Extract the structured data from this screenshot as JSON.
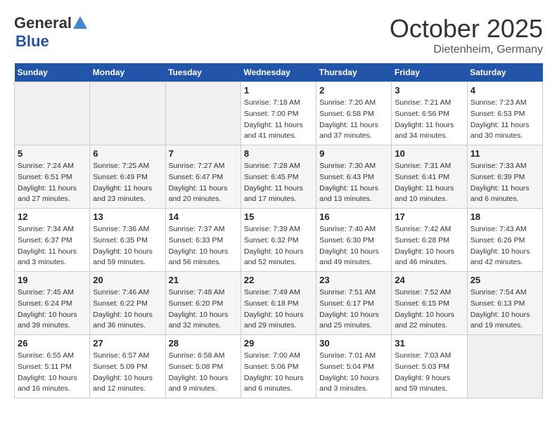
{
  "header": {
    "logo_general": "General",
    "logo_blue": "Blue",
    "month_title": "October 2025",
    "location": "Dietenheim, Germany"
  },
  "weekdays": [
    "Sunday",
    "Monday",
    "Tuesday",
    "Wednesday",
    "Thursday",
    "Friday",
    "Saturday"
  ],
  "weeks": [
    [
      null,
      null,
      null,
      {
        "day": 1,
        "sunrise": "7:18 AM",
        "sunset": "7:00 PM",
        "daylight": "11 hours and 41 minutes."
      },
      {
        "day": 2,
        "sunrise": "7:20 AM",
        "sunset": "6:58 PM",
        "daylight": "11 hours and 37 minutes."
      },
      {
        "day": 3,
        "sunrise": "7:21 AM",
        "sunset": "6:56 PM",
        "daylight": "11 hours and 34 minutes."
      },
      {
        "day": 4,
        "sunrise": "7:23 AM",
        "sunset": "6:53 PM",
        "daylight": "11 hours and 30 minutes."
      }
    ],
    [
      {
        "day": 5,
        "sunrise": "7:24 AM",
        "sunset": "6:51 PM",
        "daylight": "11 hours and 27 minutes."
      },
      {
        "day": 6,
        "sunrise": "7:25 AM",
        "sunset": "6:49 PM",
        "daylight": "11 hours and 23 minutes."
      },
      {
        "day": 7,
        "sunrise": "7:27 AM",
        "sunset": "6:47 PM",
        "daylight": "11 hours and 20 minutes."
      },
      {
        "day": 8,
        "sunrise": "7:28 AM",
        "sunset": "6:45 PM",
        "daylight": "11 hours and 17 minutes."
      },
      {
        "day": 9,
        "sunrise": "7:30 AM",
        "sunset": "6:43 PM",
        "daylight": "11 hours and 13 minutes."
      },
      {
        "day": 10,
        "sunrise": "7:31 AM",
        "sunset": "6:41 PM",
        "daylight": "11 hours and 10 minutes."
      },
      {
        "day": 11,
        "sunrise": "7:33 AM",
        "sunset": "6:39 PM",
        "daylight": "11 hours and 6 minutes."
      }
    ],
    [
      {
        "day": 12,
        "sunrise": "7:34 AM",
        "sunset": "6:37 PM",
        "daylight": "11 hours and 3 minutes."
      },
      {
        "day": 13,
        "sunrise": "7:36 AM",
        "sunset": "6:35 PM",
        "daylight": "10 hours and 59 minutes."
      },
      {
        "day": 14,
        "sunrise": "7:37 AM",
        "sunset": "6:33 PM",
        "daylight": "10 hours and 56 minutes."
      },
      {
        "day": 15,
        "sunrise": "7:39 AM",
        "sunset": "6:32 PM",
        "daylight": "10 hours and 52 minutes."
      },
      {
        "day": 16,
        "sunrise": "7:40 AM",
        "sunset": "6:30 PM",
        "daylight": "10 hours and 49 minutes."
      },
      {
        "day": 17,
        "sunrise": "7:42 AM",
        "sunset": "6:28 PM",
        "daylight": "10 hours and 46 minutes."
      },
      {
        "day": 18,
        "sunrise": "7:43 AM",
        "sunset": "6:26 PM",
        "daylight": "10 hours and 42 minutes."
      }
    ],
    [
      {
        "day": 19,
        "sunrise": "7:45 AM",
        "sunset": "6:24 PM",
        "daylight": "10 hours and 39 minutes."
      },
      {
        "day": 20,
        "sunrise": "7:46 AM",
        "sunset": "6:22 PM",
        "daylight": "10 hours and 36 minutes."
      },
      {
        "day": 21,
        "sunrise": "7:48 AM",
        "sunset": "6:20 PM",
        "daylight": "10 hours and 32 minutes."
      },
      {
        "day": 22,
        "sunrise": "7:49 AM",
        "sunset": "6:18 PM",
        "daylight": "10 hours and 29 minutes."
      },
      {
        "day": 23,
        "sunrise": "7:51 AM",
        "sunset": "6:17 PM",
        "daylight": "10 hours and 25 minutes."
      },
      {
        "day": 24,
        "sunrise": "7:52 AM",
        "sunset": "6:15 PM",
        "daylight": "10 hours and 22 minutes."
      },
      {
        "day": 25,
        "sunrise": "7:54 AM",
        "sunset": "6:13 PM",
        "daylight": "10 hours and 19 minutes."
      }
    ],
    [
      {
        "day": 26,
        "sunrise": "6:55 AM",
        "sunset": "5:11 PM",
        "daylight": "10 hours and 16 minutes."
      },
      {
        "day": 27,
        "sunrise": "6:57 AM",
        "sunset": "5:09 PM",
        "daylight": "10 hours and 12 minutes."
      },
      {
        "day": 28,
        "sunrise": "6:58 AM",
        "sunset": "5:08 PM",
        "daylight": "10 hours and 9 minutes."
      },
      {
        "day": 29,
        "sunrise": "7:00 AM",
        "sunset": "5:06 PM",
        "daylight": "10 hours and 6 minutes."
      },
      {
        "day": 30,
        "sunrise": "7:01 AM",
        "sunset": "5:04 PM",
        "daylight": "10 hours and 3 minutes."
      },
      {
        "day": 31,
        "sunrise": "7:03 AM",
        "sunset": "5:03 PM",
        "daylight": "9 hours and 59 minutes."
      },
      null
    ]
  ]
}
